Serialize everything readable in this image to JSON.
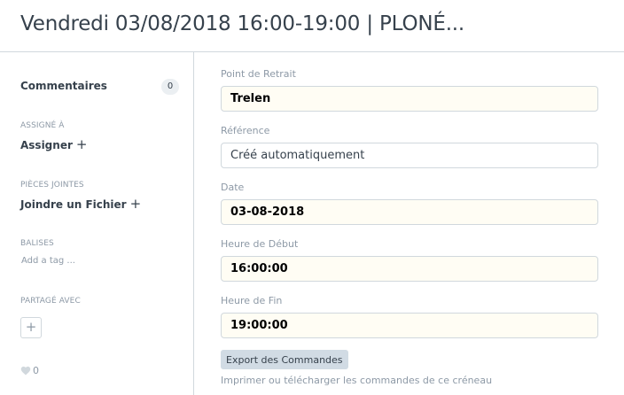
{
  "header": {
    "title": "Vendredi 03/08/2018 16:00-19:00 | PLONÉ..."
  },
  "sidebar": {
    "comments": {
      "label": "Commentaires",
      "count": "0"
    },
    "assigned": {
      "heading": "ASSIGNÉ À",
      "action": "Assigner"
    },
    "attachments": {
      "heading": "PIÈCES JOINTES",
      "action": "Joindre un Fichier"
    },
    "tags": {
      "heading": "BALISES",
      "placeholder": "Add a tag ..."
    },
    "shared": {
      "heading": "PARTAGÉ AVEC",
      "add_icon": "+"
    },
    "likes": {
      "icon": "heart-icon",
      "count": "0"
    }
  },
  "form": {
    "fields": [
      {
        "label": "Point de Retrait",
        "value": "Trelen",
        "readonly": true
      },
      {
        "label": "Référence",
        "value": "Créé automatiquement",
        "readonly": false
      },
      {
        "label": "Date",
        "value": "03-08-2018",
        "readonly": true
      },
      {
        "label": "Heure de Début",
        "value": "16:00:00",
        "readonly": true
      },
      {
        "label": "Heure de Fin",
        "value": "19:00:00",
        "readonly": true
      }
    ],
    "export_button": "Export des Commandes",
    "export_help": "Imprimer ou télécharger les commandes de ce créneau"
  },
  "colors": {
    "border": "#d1d8dd",
    "muted": "#8d99a6",
    "text": "#36414c",
    "readonly_bg": "#fffdf4",
    "button_bg": "#d1dbe4"
  }
}
